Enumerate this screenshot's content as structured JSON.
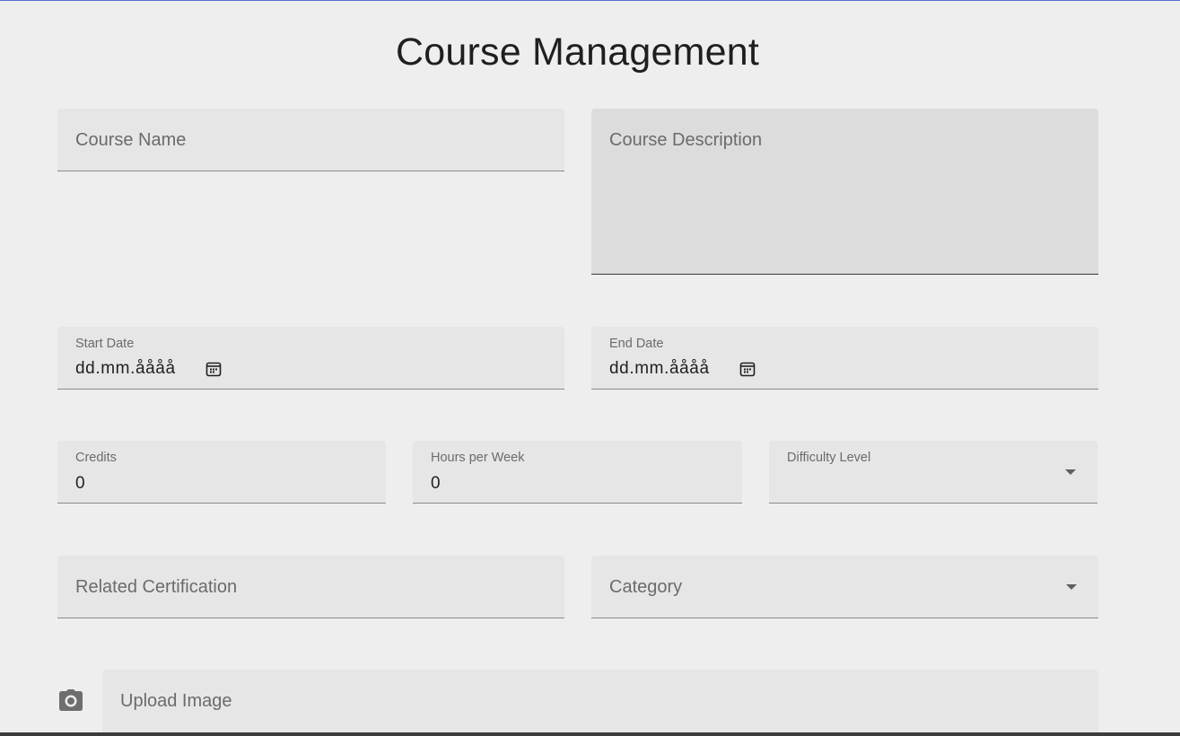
{
  "page": {
    "title": "Course Management",
    "accent_color": "#5a6fd6"
  },
  "form": {
    "course_name": {
      "placeholder": "Course Name",
      "value": ""
    },
    "course_description": {
      "placeholder": "Course Description",
      "value": ""
    },
    "start_date": {
      "label": "Start Date",
      "value": "dd.mm.åååå",
      "icon": "calendar-icon"
    },
    "end_date": {
      "label": "End Date",
      "value": "dd.mm.åååå",
      "icon": "calendar-icon"
    },
    "credits": {
      "label": "Credits",
      "value": "0"
    },
    "hours_per_week": {
      "label": "Hours per Week",
      "value": "0"
    },
    "difficulty_level": {
      "label": "Difficulty Level",
      "value": "",
      "icon": "dropdown-arrow-icon"
    },
    "related_certification": {
      "placeholder": "Related Certification",
      "value": ""
    },
    "category": {
      "placeholder": "Category",
      "value": "",
      "icon": "dropdown-arrow-icon"
    },
    "upload_image": {
      "placeholder": "Upload Image",
      "icon": "camera-icon"
    }
  }
}
